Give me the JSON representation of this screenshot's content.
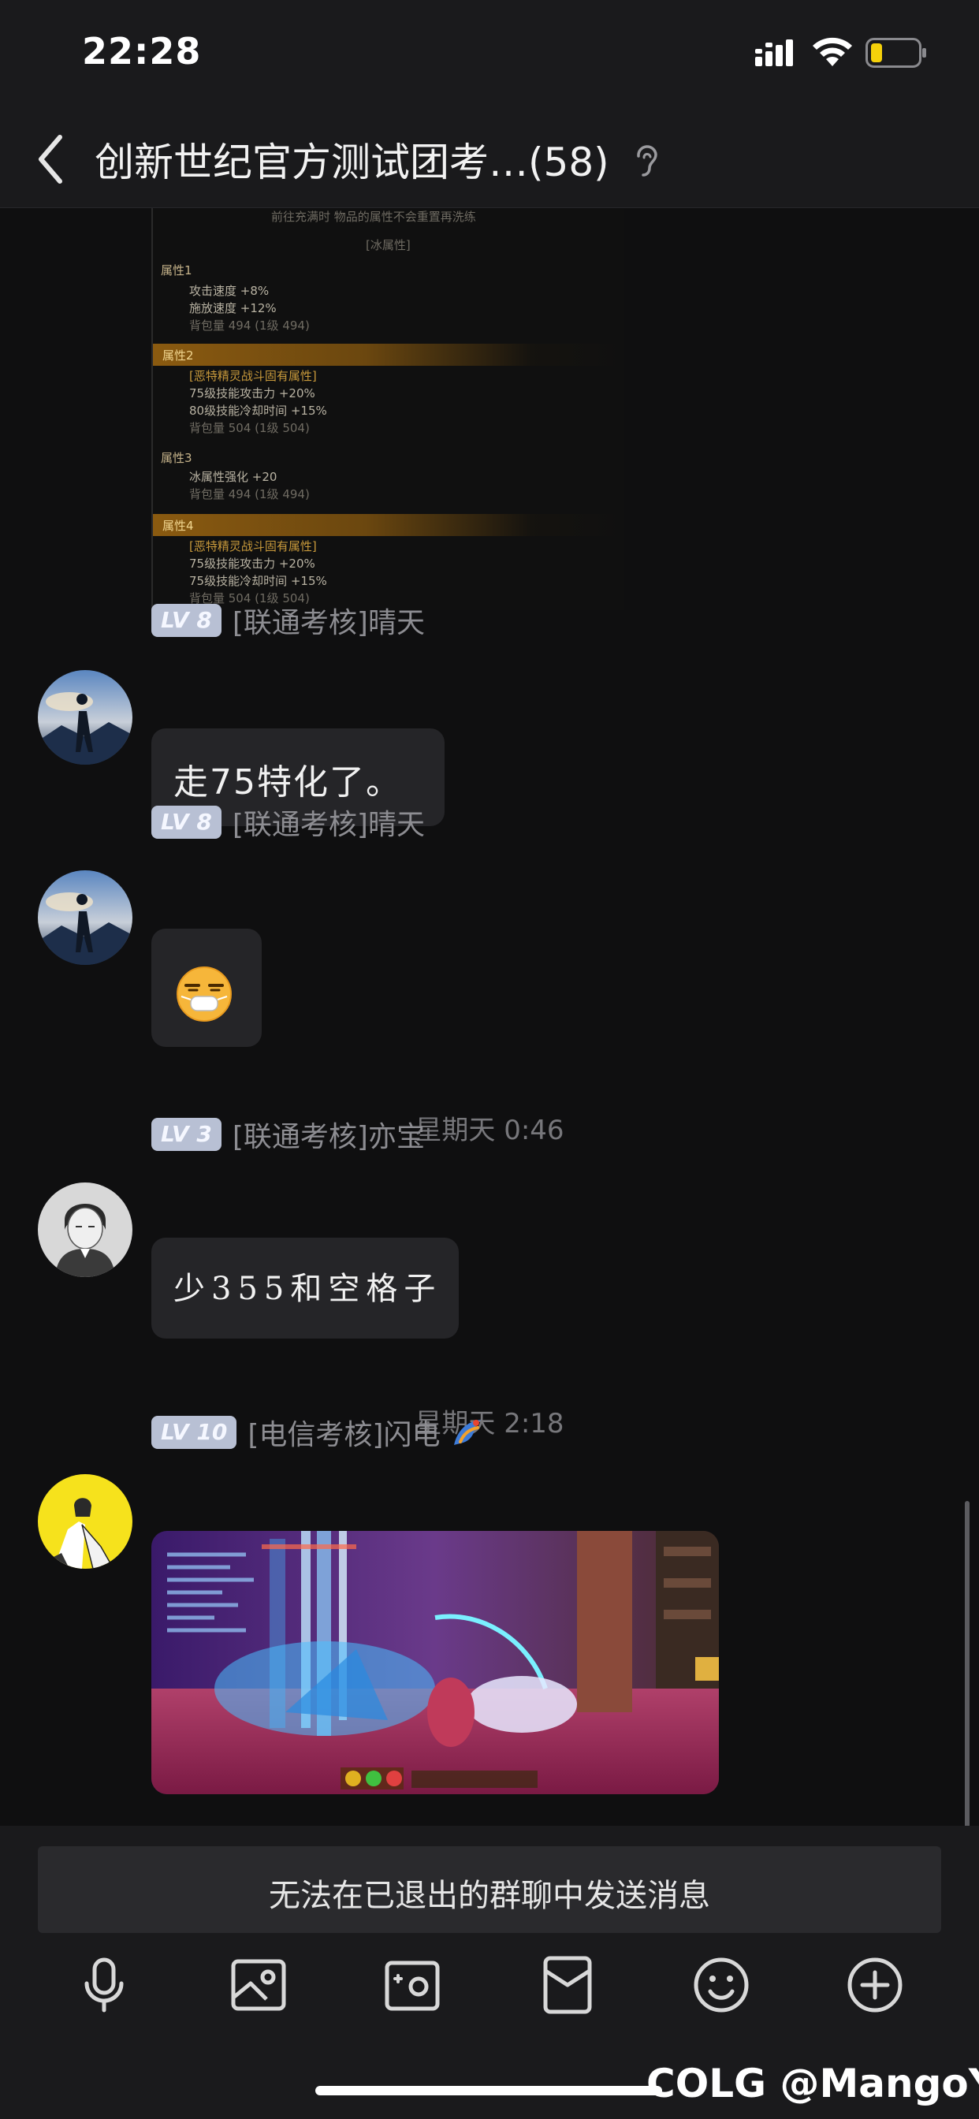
{
  "status_bar": {
    "time": "22:28"
  },
  "nav": {
    "title": "创新世纪官方测试团考…(58)"
  },
  "screenshot_card": {
    "lines": [
      "前往充满时 物品的属性不会重置再洗练",
      "[冰属性]",
      "属性1",
      "攻击速度 +8%",
      "施放速度 +12%",
      "背包量 494 (1级 494)",
      "属性2",
      "[恶特精灵战斗固有属性]",
      "75级技能攻击力 +20%",
      "80级技能冷却时间 +15%",
      "背包量 504 (1级 504)",
      "属性3",
      "冰属性强化 +20",
      "背包量 494 (1级 494)",
      "属性4",
      "[恶特精灵战斗固有属性]",
      "75级技能攻击力 +20%",
      "75级技能冷却时间 +15%",
      "背包量 504 (1级 504)"
    ]
  },
  "messages": [
    {
      "level": "LV 8",
      "sender": "[联通考核]晴天",
      "text": "走75特化了。"
    },
    {
      "level": "LV 8",
      "sender": "[联通考核]晴天",
      "emoji": "sticker-emoji"
    },
    {
      "timestamp": "星期天 0:46"
    },
    {
      "level": "LV 3",
      "sender": "[联通考核]亦宝",
      "text": "少355和空格子"
    },
    {
      "timestamp": "星期天 2:18"
    },
    {
      "level": "LV 10",
      "sender": "[电信考核]闪电",
      "image": "game-screenshot"
    }
  ],
  "input": {
    "notice": "无法在已退出的群聊中发送消息"
  },
  "toolbar": [
    "mic-icon",
    "image-icon",
    "camera-icon",
    "red-packet-icon",
    "emoji-icon",
    "plus-icon"
  ],
  "watermark": "COLG @MangoY",
  "colors": {
    "background": "#0f0f10",
    "bubble": "#252528",
    "badge": "#b8c0d4",
    "panel": "#1a1a1c"
  }
}
